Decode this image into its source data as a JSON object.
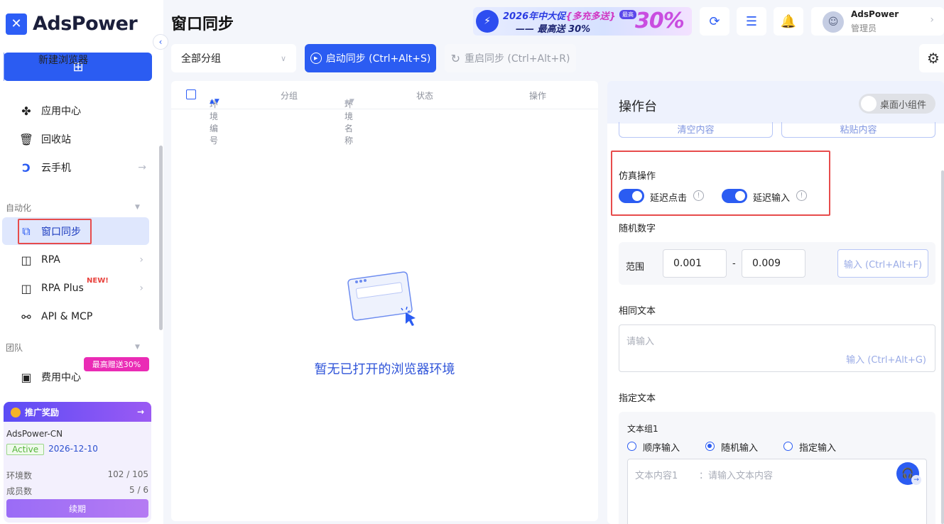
{
  "app": {
    "name": "AdsPower"
  },
  "sidebar": {
    "new_browser_label": "新建浏览器",
    "items": [
      {
        "label": "应用中心",
        "icon": "puzzle-icon"
      },
      {
        "label": "回收站",
        "icon": "trash-icon"
      },
      {
        "label": "云手机",
        "icon": "cloud-phone-icon"
      }
    ],
    "section_automation": "自动化",
    "automation_items": [
      {
        "label": "窗口同步",
        "icon": "window-sync-icon",
        "active": true
      },
      {
        "label": "RPA",
        "icon": "robot-icon"
      },
      {
        "label": "RPA Plus",
        "icon": "robot-icon",
        "badge": "NEW!"
      },
      {
        "label": "API & MCP",
        "icon": "plug-icon"
      }
    ],
    "section_team": "团队",
    "team_items": [
      {
        "label": "费用中心",
        "icon": "wallet-icon",
        "badge": "最高赠送30%"
      }
    ],
    "referral": {
      "title": "推广奖励",
      "account": "AdsPower-CN",
      "status": "Active",
      "expiry": "2026-12-10",
      "env_label": "环境数",
      "env_value": "102 / 105",
      "member_label": "成员数",
      "member_value": "5 / 6",
      "renew_label": "续期"
    }
  },
  "header": {
    "title": "窗口同步",
    "promo_line1": "2026年中大促",
    "promo_line1_b": "{多充多送}",
    "promo_tag": "最高",
    "promo_line2": "—— 最高送 30%",
    "promo_big": "30%",
    "user_name": "AdsPower",
    "user_role": "管理员"
  },
  "toolbar": {
    "group_select": "全部分组",
    "start_sync": "启动同步 (Ctrl+Alt+S)",
    "restart_sync": "重启同步 (Ctrl+Alt+R)"
  },
  "table": {
    "columns": [
      "环境编号",
      "分组",
      "环境名称",
      "状态",
      "操作"
    ],
    "empty_text": "暂无已打开的浏览器环境"
  },
  "console": {
    "title": "操作台",
    "widget_toggle": "桌面小组件",
    "clear_content": "清空内容",
    "paste_content": "粘贴内容",
    "sim_title": "仿真操作",
    "delay_click": "延迟点击",
    "delay_input": "延迟输入",
    "random_number_title": "随机数字",
    "range_label": "范围",
    "range_min": "0.001",
    "range_sep": "-",
    "range_max": "0.009",
    "random_input_btn": "输入 (Ctrl+Alt+F)",
    "same_text_title": "相同文本",
    "same_text_placeholder": "请输入",
    "same_text_btn": "输入 (Ctrl+Alt+G)",
    "specified_text_title": "指定文本",
    "group_label": "文本组1",
    "radio_options": [
      "顺序输入",
      "随机输入",
      "指定输入"
    ],
    "selected_radio": "随机输入",
    "text_content_label": "文本内容1",
    "text_content_placeholder": "：请输入文本内容"
  }
}
